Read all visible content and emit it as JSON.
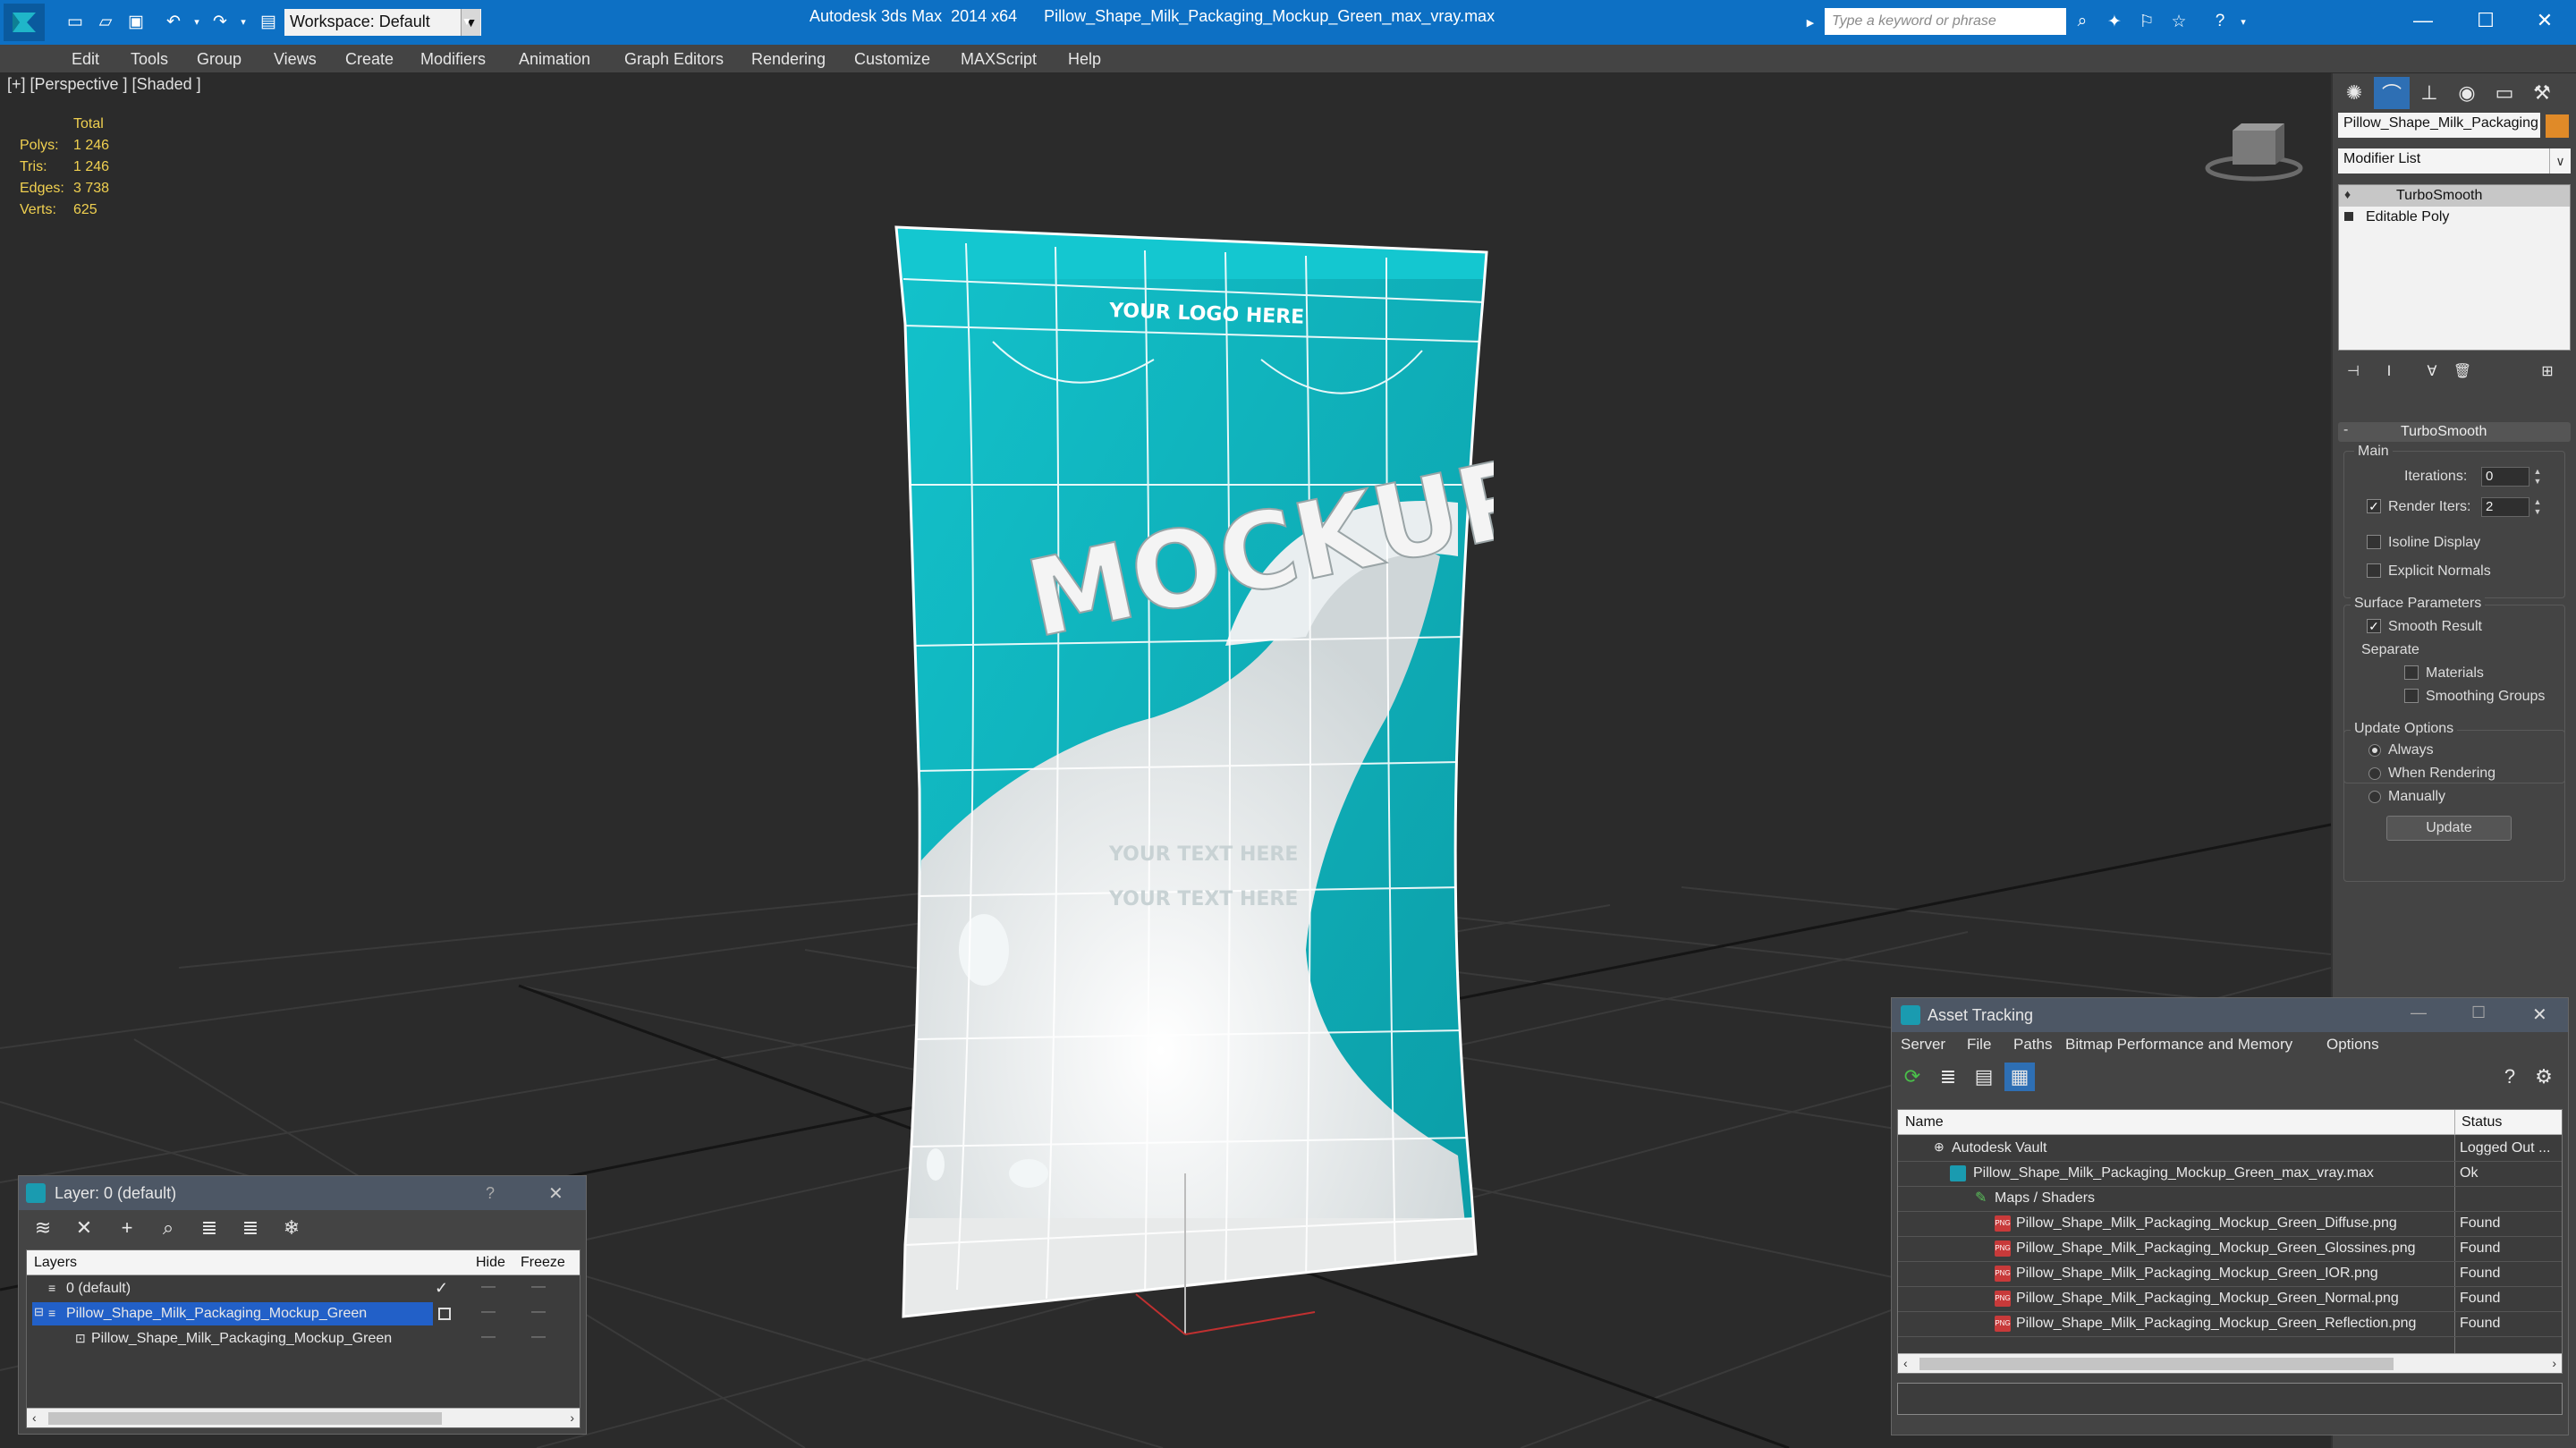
{
  "app": {
    "title": "Autodesk 3ds Max  2014 x64      Pillow_Shape_Milk_Packaging_Mockup_Green_max_vray.max",
    "workspace": "Workspace: Default",
    "search_placeholder": "Type a keyword or phrase"
  },
  "menu": [
    "Edit",
    "Tools",
    "Group",
    "Views",
    "Create",
    "Modifiers",
    "Animation",
    "Graph Editors",
    "Rendering",
    "Customize",
    "MAXScript",
    "Help"
  ],
  "viewport": {
    "label": "[+] [Perspective ] [Shaded ]",
    "stats": {
      "header": "Total",
      "rows": [
        {
          "label": "Polys:",
          "value": "1 246"
        },
        {
          "label": "Tris:",
          "value": "1 246"
        },
        {
          "label": "Edges:",
          "value": "3 738"
        },
        {
          "label": "Verts:",
          "value": "625"
        }
      ]
    },
    "package": {
      "logo_text": "YOUR LOGO HERE",
      "brand_text": "MOCKUP",
      "line1": "YOUR TEXT HERE",
      "line2": "YOUR TEXT HERE"
    }
  },
  "command_panel": {
    "object_name": "Pillow_Shape_Milk_Packaging",
    "object_color": "#e08a28",
    "modifier_list": "Modifier List",
    "stack": [
      "TurboSmooth",
      "Editable Poly"
    ],
    "turbosmooth": {
      "title": "TurboSmooth",
      "main": "Main",
      "iterations_label": "Iterations:",
      "iterations": "0",
      "render_iters_label": "Render Iters:",
      "render_iters": "2",
      "isoline": "Isoline Display",
      "explicit_normals": "Explicit Normals",
      "surface_params": "Surface Parameters",
      "smooth_result": "Smooth Result",
      "separate": "Separate",
      "materials": "Materials",
      "smoothing_groups": "Smoothing Groups",
      "update_options": "Update Options",
      "always": "Always",
      "when_rendering": "When Rendering",
      "manually": "Manually",
      "update_button": "Update"
    }
  },
  "layer_window": {
    "title": "Layer: 0 (default)",
    "help": "?",
    "col_layers": "Layers",
    "col_hide": "Hide",
    "col_freeze": "Freeze",
    "rows": [
      {
        "name": "0 (default)",
        "selected": false,
        "indent": 0
      },
      {
        "name": "Pillow_Shape_Milk_Packaging_Mockup_Green",
        "selected": true,
        "indent": 0
      },
      {
        "name": "Pillow_Shape_Milk_Packaging_Mockup_Green",
        "selected": false,
        "indent": 1
      }
    ]
  },
  "asset_window": {
    "title": "Asset Tracking",
    "menu": [
      "Server",
      "File",
      "Paths",
      "Bitmap Performance and Memory",
      "Options"
    ],
    "col_name": "Name",
    "col_status": "Status",
    "rows": [
      {
        "name": "Autodesk Vault",
        "status": "Logged Out ...",
        "indent": 1,
        "icon": "vault"
      },
      {
        "name": "Pillow_Shape_Milk_Packaging_Mockup_Green_max_vray.max",
        "status": "Ok",
        "indent": 2,
        "icon": "max"
      },
      {
        "name": "Maps / Shaders",
        "status": "",
        "indent": 3,
        "icon": "maps"
      },
      {
        "name": "Pillow_Shape_Milk_Packaging_Mockup_Green_Diffuse.png",
        "status": "Found",
        "indent": 4,
        "icon": "png"
      },
      {
        "name": "Pillow_Shape_Milk_Packaging_Mockup_Green_Glossines.png",
        "status": "Found",
        "indent": 4,
        "icon": "png"
      },
      {
        "name": "Pillow_Shape_Milk_Packaging_Mockup_Green_IOR.png",
        "status": "Found",
        "indent": 4,
        "icon": "png"
      },
      {
        "name": "Pillow_Shape_Milk_Packaging_Mockup_Green_Normal.png",
        "status": "Found",
        "indent": 4,
        "icon": "png"
      },
      {
        "name": "Pillow_Shape_Milk_Packaging_Mockup_Green_Reflection.png",
        "status": "Found",
        "indent": 4,
        "icon": "png"
      }
    ]
  }
}
